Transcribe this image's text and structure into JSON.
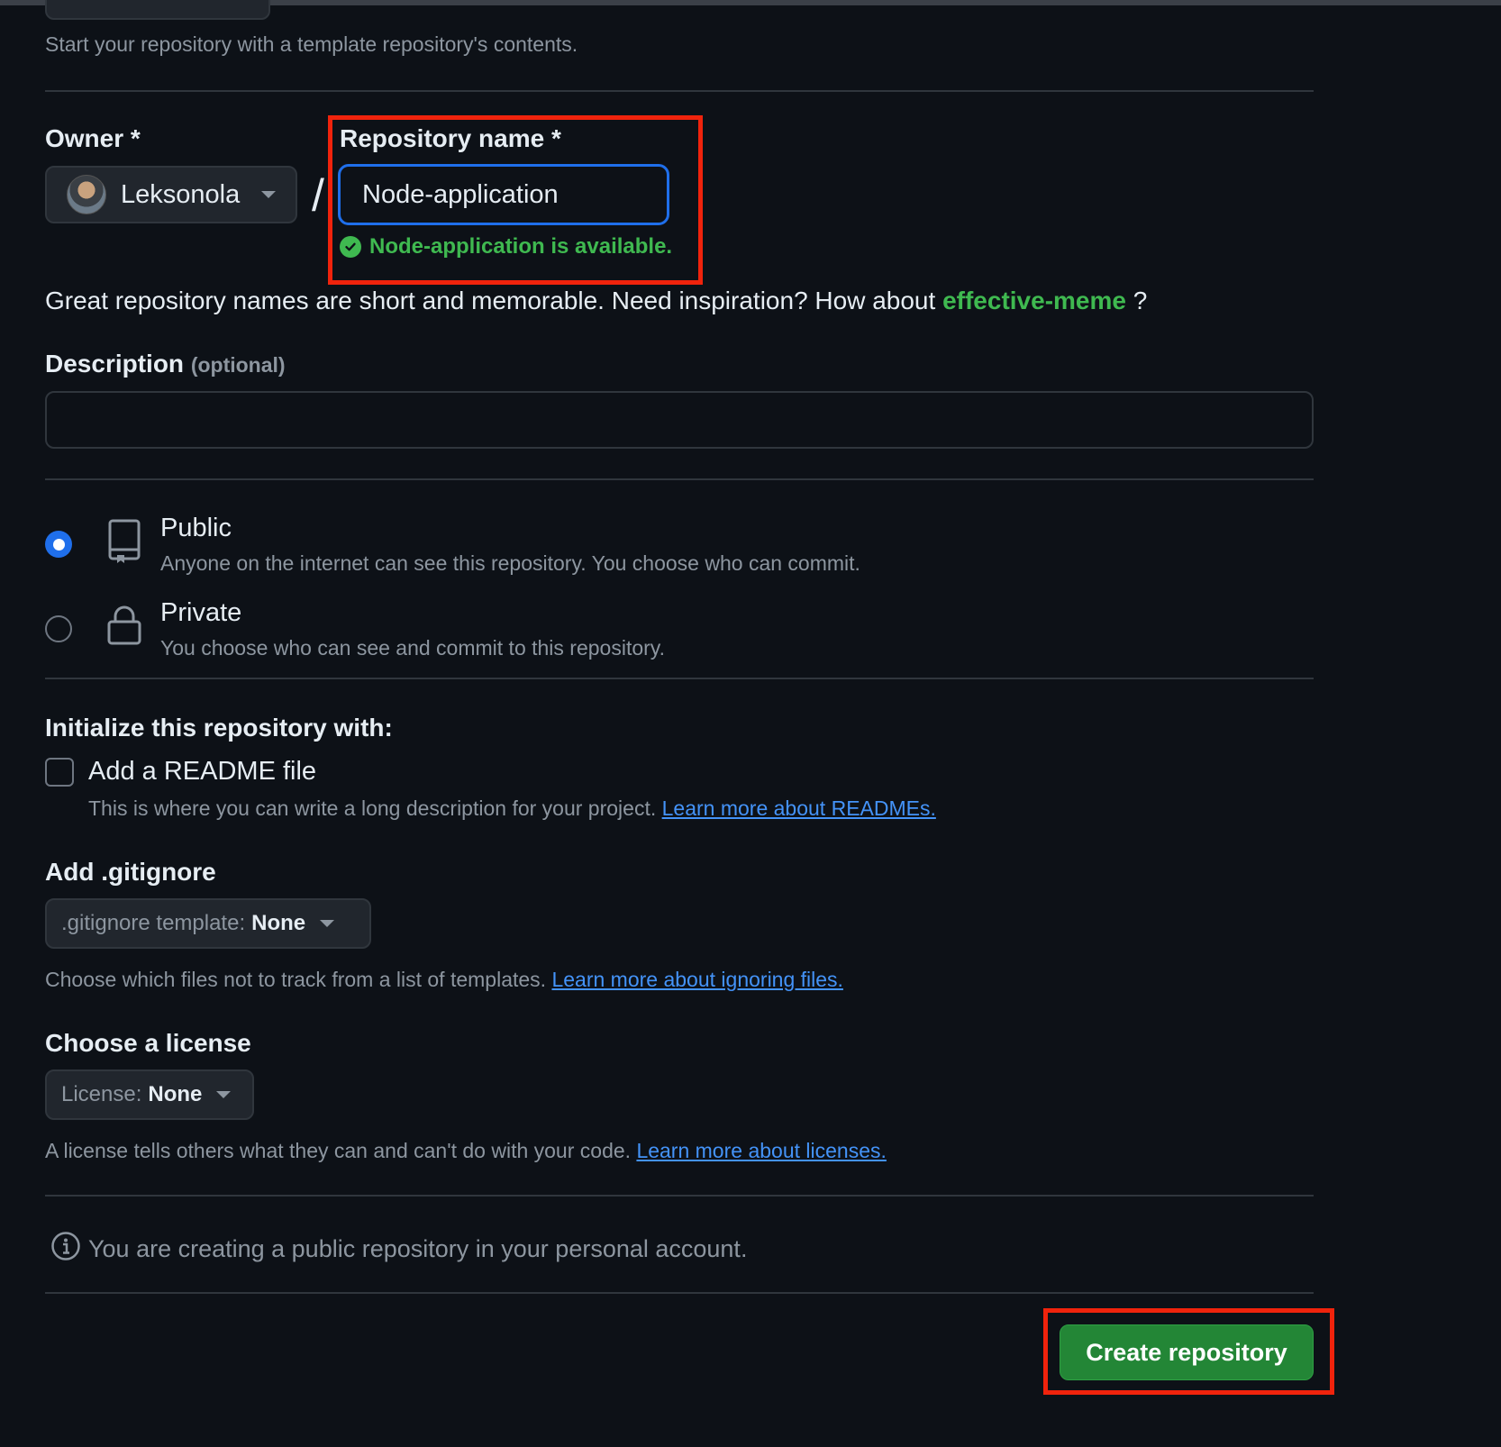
{
  "template": {
    "description": "Start your repository with a template repository's contents."
  },
  "owner": {
    "label": "Owner *",
    "value": "Leksonola",
    "separator": "/"
  },
  "repository_name": {
    "label": "Repository name *",
    "value": "Node-application",
    "availability": "Node-application is available."
  },
  "inspiration": {
    "text": "Great repository names are short and memorable. Need inspiration? How about",
    "suggestion": "effective-meme",
    "suffix": "?"
  },
  "description": {
    "label": "Description",
    "optional": "(optional)",
    "value": ""
  },
  "visibility": {
    "selected": "public",
    "public_title": "Public",
    "public_desc": "Anyone on the internet can see this repository. You choose who can commit.",
    "private_title": "Private",
    "private_desc": "You choose who can see and commit to this repository."
  },
  "initialize": {
    "label": "Initialize this repository with:",
    "readme_label": "Add a README file",
    "readme_checked": false,
    "readme_desc": "This is where you can write a long description for your project.",
    "readme_link": "Learn more about READMEs."
  },
  "gitignore": {
    "label": "Add .gitignore",
    "prefix": ".gitignore template:",
    "value": "None",
    "desc": "Choose which files not to track from a list of templates.",
    "link": "Learn more about ignoring files."
  },
  "license": {
    "label": "Choose a license",
    "prefix": "License:",
    "value": "None",
    "desc": "A license tells others what they can and can't do with your code.",
    "link": "Learn more about licenses."
  },
  "notice": {
    "text": "You are creating a public repository in your personal account."
  },
  "actions": {
    "create_label": "Create repository"
  },
  "colors": {
    "background": "#0d1117",
    "accent_blue": "#1f6feb",
    "success_green": "#3fb950",
    "button_green": "#238636",
    "highlight_red": "#f0230c",
    "link_blue": "#4493f8"
  }
}
